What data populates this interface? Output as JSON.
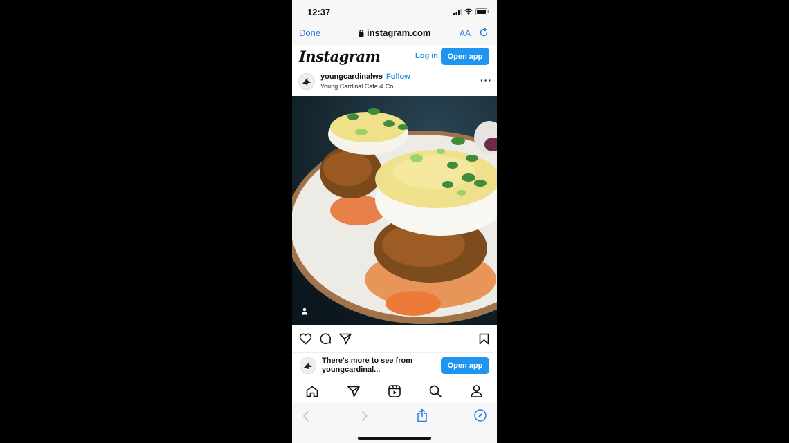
{
  "status_bar": {
    "time": "12:37"
  },
  "browser": {
    "done_label": "Done",
    "url": "instagram.com",
    "text_size_label": "AA"
  },
  "ig_header": {
    "logo": "Instagram",
    "login_label": "Log in",
    "open_app_label": "Open app"
  },
  "post": {
    "username": "youngcardinalws",
    "separator": "•",
    "follow_label": "Follow",
    "location": "Young Cardinal Cafe & Co.",
    "more_label": "···"
  },
  "banner": {
    "text_line1": "There's more to see from",
    "text_line2": "youngcardinal...",
    "open_app_label": "Open app"
  },
  "icons": {
    "status": [
      "signal-icon",
      "wifi-icon",
      "battery-icon"
    ],
    "actions": [
      "heart-icon",
      "comment-icon",
      "share-icon",
      "bookmark-icon"
    ],
    "tabbar": [
      "home-icon",
      "direct-icon",
      "reels-icon",
      "search-icon",
      "profile-icon"
    ],
    "safari": [
      "back-icon",
      "forward-icon",
      "share-icon",
      "compass-icon"
    ]
  },
  "colors": {
    "accent": "#1e95f0",
    "safari_blue": "#2f7be0"
  }
}
